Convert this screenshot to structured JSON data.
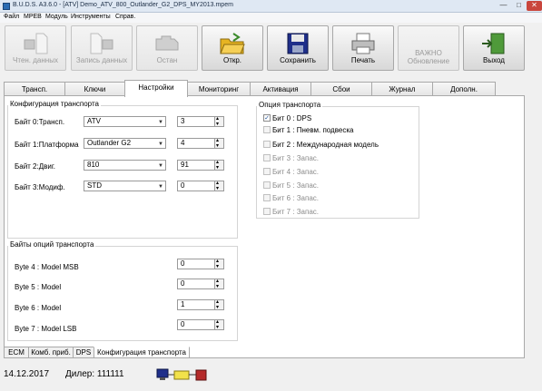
{
  "window": {
    "title": "B.U.D.S. A3.6.0 - [ATV] Demo_ATV_800_Outlander_G2_DPS_MY2013.mpem",
    "minimize": "—",
    "maximize": "□",
    "close": "✕"
  },
  "menu": [
    "Файл",
    "MPEB",
    "Модуль",
    "Инструменты",
    "Справ."
  ],
  "toolbar": {
    "read": "Чтен. данных",
    "write": "Запись данных",
    "stop": "Остан",
    "open": "Откр.",
    "save": "Сохранить",
    "print": "Печать",
    "important_line1": "ВАЖНО",
    "important_line2": "Обновление",
    "exit": "Выход"
  },
  "tabs": [
    "Трансп.",
    "Ключи",
    "Настройки",
    "Мониторинг",
    "Активация",
    "Сбои",
    "Журнал",
    "Дополн."
  ],
  "config": {
    "title": "Конфигурация транспорта",
    "rows": [
      {
        "label": "Байт 0:Трансп.",
        "value": "ATV",
        "num": "3"
      },
      {
        "label": "Байт 1:Платформа",
        "value": "Outlander G2",
        "num": "4"
      },
      {
        "label": "Байт 2:Двиг.",
        "value": "810",
        "num": "91"
      },
      {
        "label": "Байт 3:Модиф.",
        "value": "STD",
        "num": "0"
      }
    ]
  },
  "options_bytes": {
    "title": "Байты опций транспорта",
    "rows": [
      {
        "label": "Byte 4 : Model MSB",
        "num": "0"
      },
      {
        "label": "Byte 5 : Model",
        "num": "0"
      },
      {
        "label": "Byte 6 : Model",
        "num": "1"
      },
      {
        "label": "Byte 7 : Model LSB",
        "num": "0"
      }
    ]
  },
  "vehicle_option": {
    "title": "Опция транспорта",
    "items": [
      {
        "label": "Бит 0 : DPS",
        "mark": "✓"
      },
      {
        "label": "Бит 1 : Пневм. подвеска",
        "mark": ""
      },
      {
        "label": "Бит 2 : Международная модель",
        "mark": ""
      },
      {
        "label": "Бит 3 : Запас.",
        "mark": ""
      },
      {
        "label": "Бит 4 : Запас.",
        "mark": ""
      },
      {
        "label": "Бит 5 : Запас.",
        "mark": ""
      },
      {
        "label": "Бит 6 : Запас.",
        "mark": ""
      },
      {
        "label": "Бит 7 : Запас.",
        "mark": ""
      }
    ]
  },
  "bottom_tabs": [
    "ECM",
    "Комб. приб.",
    "DPS",
    "Конфигурация транспорта"
  ],
  "status": {
    "date": "14.12.2017",
    "dealer": "Дилер: 111111"
  },
  "colors": {
    "accent": "#2b6cb3",
    "folder": "#e6b422",
    "disk": "#1f2f8a",
    "exit_green": "#4f9a3a"
  }
}
